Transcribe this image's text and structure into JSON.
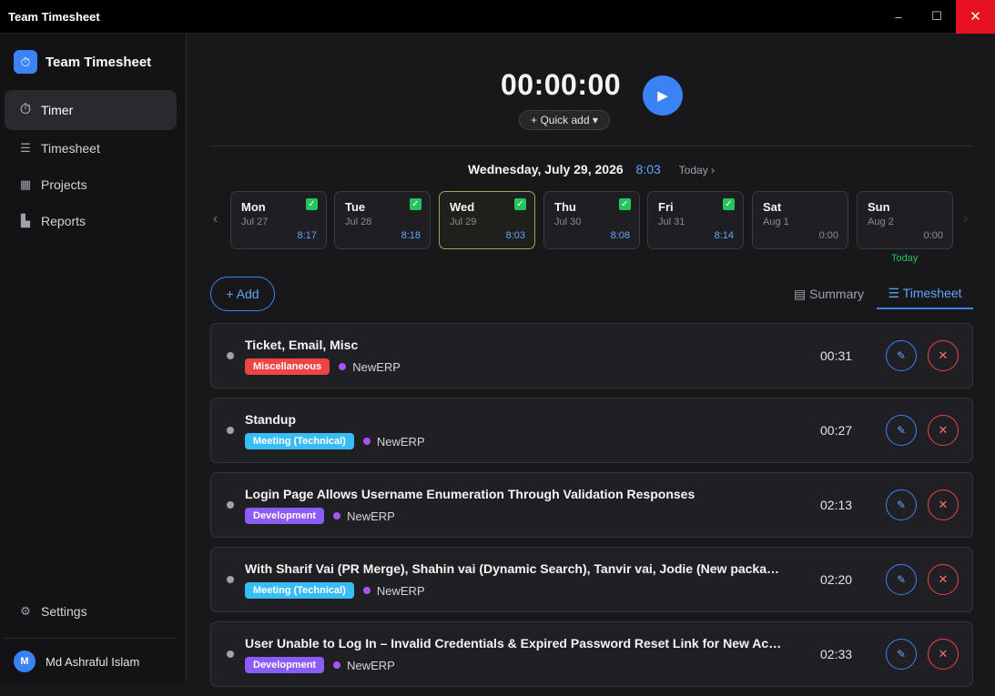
{
  "window": {
    "title": "Team Timesheet",
    "minimize": "–",
    "maximize": "☐",
    "close": "✕"
  },
  "sidebar": {
    "brand": "Team Timesheet",
    "items": [
      {
        "label": "Timer",
        "icon": "⏱"
      },
      {
        "label": "Timesheet",
        "icon": "☰"
      },
      {
        "label": "Projects",
        "icon": "▦"
      },
      {
        "label": "Reports",
        "icon": "▙"
      }
    ],
    "settings": {
      "label": "Settings",
      "icon": "⚙"
    },
    "user": {
      "initial": "M",
      "name": "Md Ashraful Islam"
    }
  },
  "timer": {
    "display": "00:00:00",
    "play_icon": "▶",
    "quick_add": "+ Quick add ▾"
  },
  "date_bar": {
    "date": "Wednesday, July 29, 2026",
    "time": "8:03",
    "today": "Today ›"
  },
  "week": {
    "prev": "‹",
    "next": "›",
    "days": [
      {
        "name": "Mon",
        "date": "Jul 27",
        "hours": "8:17",
        "checked": true
      },
      {
        "name": "Tue",
        "date": "Jul 28",
        "hours": "8:18",
        "checked": true
      },
      {
        "name": "Wed",
        "date": "Jul 29",
        "hours": "8:03",
        "checked": true
      },
      {
        "name": "Thu",
        "date": "Jul 30",
        "hours": "8:08",
        "checked": true
      },
      {
        "name": "Fri",
        "date": "Jul 31",
        "hours": "8:14",
        "checked": true
      },
      {
        "name": "Sat",
        "date": "Aug 1",
        "hours": "0:00",
        "checked": false
      },
      {
        "name": "Sun",
        "date": "Aug 2",
        "hours": "0:00",
        "checked": false
      }
    ],
    "today_label": "Today",
    "check_glyph": "✓"
  },
  "actions": {
    "add": "+ Add",
    "summary_tab": "▤ Summary",
    "timesheet_tab": "☰ Timesheet"
  },
  "entries": [
    {
      "title": "Ticket, Email, Misc",
      "tag": "Miscellaneous",
      "tag_color": "#ef4444",
      "project": "NewERP",
      "duration": "00:31"
    },
    {
      "title": "Standup",
      "tag": "Meeting (Technical)",
      "tag_color": "#38bdf8",
      "project": "NewERP",
      "duration": "00:27"
    },
    {
      "title": "Login Page Allows Username Enumeration Through Validation Responses",
      "tag": "Development",
      "tag_color": "#8b5cf6",
      "project": "NewERP",
      "duration": "02:13"
    },
    {
      "title": "With Sharif Vai (PR Merge), Shahin vai (Dynamic Search), Tanvir vai, Jodie (New package …",
      "tag": "Meeting (Technical)",
      "tag_color": "#38bdf8",
      "project": "NewERP",
      "duration": "02:20"
    },
    {
      "title": "User Unable to Log In – Invalid Credentials & Expired Password Reset Link for New Accou…",
      "tag": "Development",
      "tag_color": "#8b5cf6",
      "project": "NewERP",
      "duration": "02:33"
    }
  ],
  "entry_icons": {
    "edit": "✎",
    "delete": "✕"
  },
  "colors": {
    "accent": "#3b82f6",
    "success": "#22c55e",
    "danger": "#ef4444",
    "project_dot": "#a855f7"
  }
}
